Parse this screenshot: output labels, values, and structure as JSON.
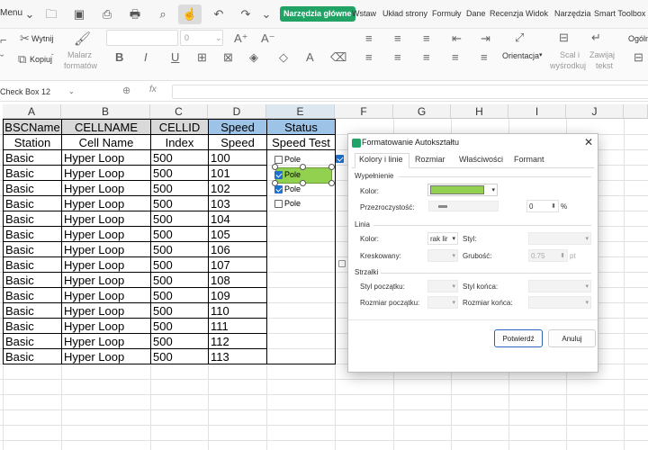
{
  "app": {
    "accent": "#21a366",
    "menu_label": "Menu"
  },
  "tabs": [
    {
      "label": "Narzędzia główne"
    },
    {
      "label": "Wstaw"
    },
    {
      "label": "Układ strony"
    },
    {
      "label": "Formuły"
    },
    {
      "label": "Dane"
    },
    {
      "label": "Recenzja"
    },
    {
      "label": "Widok"
    },
    {
      "label": "Narzędzia"
    },
    {
      "label": "Smart Toolbox"
    }
  ],
  "ribbon": {
    "cut": "Wytnij",
    "copy": "Kopiuj",
    "format_painter": [
      "Malarz",
      "formatów"
    ],
    "font_size": "0",
    "orientation": "Orientacja",
    "merge": [
      "Scal i",
      "wyśrodkuj"
    ],
    "wrap": [
      "Zawijaj",
      "tekst"
    ],
    "general": "Ogóln"
  },
  "formula_bar": {
    "name_box": "Check Box 12",
    "fx": "fx"
  },
  "sheet": {
    "columns": [
      "A",
      "B",
      "C",
      "D",
      "E",
      "F",
      "G",
      "H",
      "I",
      "J"
    ],
    "header_row1": [
      "BSCName",
      "CELLNAME",
      "CELLID",
      "Speed",
      "Status"
    ],
    "header_row2": [
      "Station",
      "Cell Name",
      "Index",
      "Speed",
      "Speed Test"
    ],
    "rows": [
      [
        "Basic",
        "Hyper Loop",
        "500",
        "100"
      ],
      [
        "Basic",
        "Hyper Loop",
        "500",
        "101"
      ],
      [
        "Basic",
        "Hyper Loop",
        "500",
        "102"
      ],
      [
        "Basic",
        "Hyper Loop",
        "500",
        "103"
      ],
      [
        "Basic",
        "Hyper Loop",
        "500",
        "104"
      ],
      [
        "Basic",
        "Hyper Loop",
        "500",
        "105"
      ],
      [
        "Basic",
        "Hyper Loop",
        "500",
        "106"
      ],
      [
        "Basic",
        "Hyper Loop",
        "500",
        "107"
      ],
      [
        "Basic",
        "Hyper Loop",
        "500",
        "108"
      ],
      [
        "Basic",
        "Hyper Loop",
        "500",
        "109"
      ],
      [
        "Basic",
        "Hyper Loop",
        "500",
        "110"
      ],
      [
        "Basic",
        "Hyper Loop",
        "500",
        "111"
      ],
      [
        "Basic",
        "Hyper Loop",
        "500",
        "112"
      ],
      [
        "Basic",
        "Hyper Loop",
        "500",
        "113"
      ]
    ],
    "checkboxes": [
      {
        "label": "Pole",
        "checked": false
      },
      {
        "label": "Pole",
        "checked": true
      },
      {
        "label": "Pole",
        "checked": true
      },
      {
        "label": "Pole",
        "checked": false
      }
    ],
    "shape_fill": "#92d050"
  },
  "dialog": {
    "title": "Formatowanie Autokształtu",
    "close": "✕",
    "tabs": [
      "Kolory i linie",
      "Rozmiar",
      "Właściwości",
      "Formant"
    ],
    "fill_section": "Wypełnienie",
    "fill_color_label": "Kolor:",
    "fill_color": "#92d050",
    "transparency_label": "Przezroczystość:",
    "transparency_value": "0",
    "transparency_unit": "%",
    "line_section": "Linia",
    "line_color_label": "Kolor:",
    "line_color_value": "rak lir",
    "style_label": "Styl:",
    "dashed_label": "Kreskowany:",
    "weight_label": "Grubość:",
    "weight_value": "0.75",
    "weight_unit": "pt",
    "arrows_section": "Strzałki",
    "begin_style_label": "Styl początku:",
    "end_style_label": "Styl końca:",
    "begin_size_label": "Rozmiar początku:",
    "end_size_label": "Rozmiar końca:",
    "ok": "Potwierdź",
    "cancel": "Anuluj"
  }
}
